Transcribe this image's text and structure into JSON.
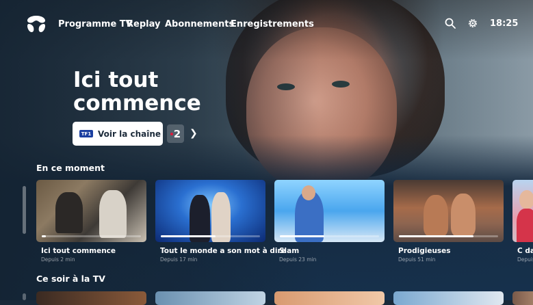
{
  "nav": {
    "items": [
      "Programme TV",
      "Replay",
      "Abonnements",
      "Enregistrements"
    ],
    "clock": "18:25"
  },
  "hero": {
    "title": "Ici tout commence",
    "watch_label": "Voir la chaîne",
    "channel_logo": "TF1",
    "next_channel": "2"
  },
  "sections": {
    "now": "En ce moment",
    "tonight": "Ce soir à la TV"
  },
  "now_cards": [
    {
      "title": "Ici tout commence",
      "subtitle": "Depuis 2 min",
      "progress": 0.04
    },
    {
      "title": "Tout le monde a son mot à dire",
      "subtitle": "Depuis 17 min",
      "progress": 0.55
    },
    {
      "title": "Slam",
      "subtitle": "Depuis 23 min",
      "progress": 0.45
    },
    {
      "title": "Prodigieuses",
      "subtitle": "Depuis 51 min",
      "progress": 0.75
    },
    {
      "title": "C dan",
      "subtitle": "Depuis",
      "progress": 0.4
    }
  ],
  "colors": {
    "background": "#16314d",
    "accent_channel2": "#e0193a",
    "tf1_blue": "#1b3fa0"
  }
}
